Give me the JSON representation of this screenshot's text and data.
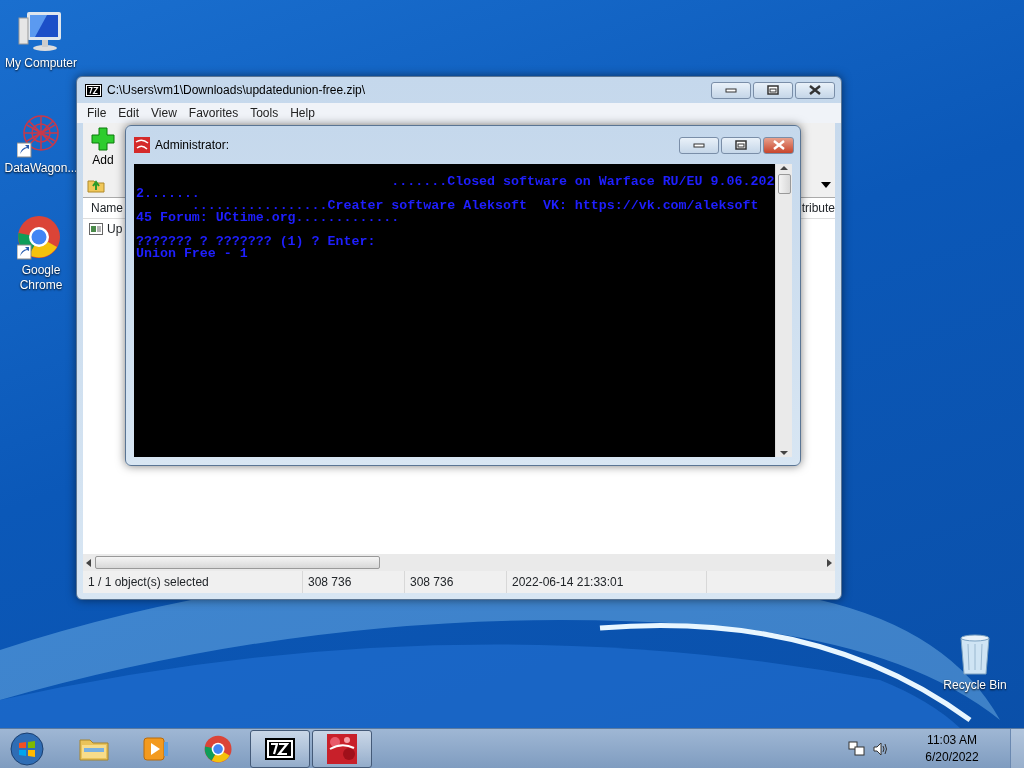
{
  "desktop_icons": [
    {
      "kind": "computer",
      "label": "My Computer"
    },
    {
      "kind": "datawagon",
      "label": "DataWagon..."
    },
    {
      "kind": "chrome",
      "label": "Google Chrome"
    },
    {
      "kind": "recycle",
      "label": "Recycle Bin"
    }
  ],
  "archive_window": {
    "title": "C:\\Users\\vm1\\Downloads\\updatedunion-free.zip\\",
    "menu": [
      "File",
      "Edit",
      "View",
      "Favorites",
      "Tools",
      "Help"
    ],
    "toolbar": [
      {
        "label": "Add"
      }
    ],
    "columns": [
      "Name",
      "tribute"
    ],
    "rows": [
      {
        "name": "Up"
      }
    ],
    "status_bar": [
      "1 / 1 object(s) selected",
      "308 736",
      "308 736",
      "2022-06-14 21:33:01"
    ]
  },
  "console_window": {
    "title": "Administrator:",
    "paragraphs": [
      {
        "lines": [
          "                                .......Closed software on Warface RU/EU 9.06.202",
          "2.......",
          "       .................Creater software Aleksoft  VK: https://vk.com/aleksoft",
          "45 Forum: UCtime.org............."
        ]
      },
      {
        "lines": [
          "??????? ? ??????? (1) ? Enter:",
          "Union Free - 1"
        ]
      }
    ]
  },
  "taskbar": {
    "items": [
      {
        "kind": "folder",
        "running": false
      },
      {
        "kind": "media",
        "running": false
      },
      {
        "kind": "chrome",
        "running": false
      },
      {
        "kind": "sevenzip",
        "running": true
      },
      {
        "kind": "redapp",
        "running": true
      }
    ],
    "time": "11:03 AM",
    "date": "6/20/2022"
  }
}
